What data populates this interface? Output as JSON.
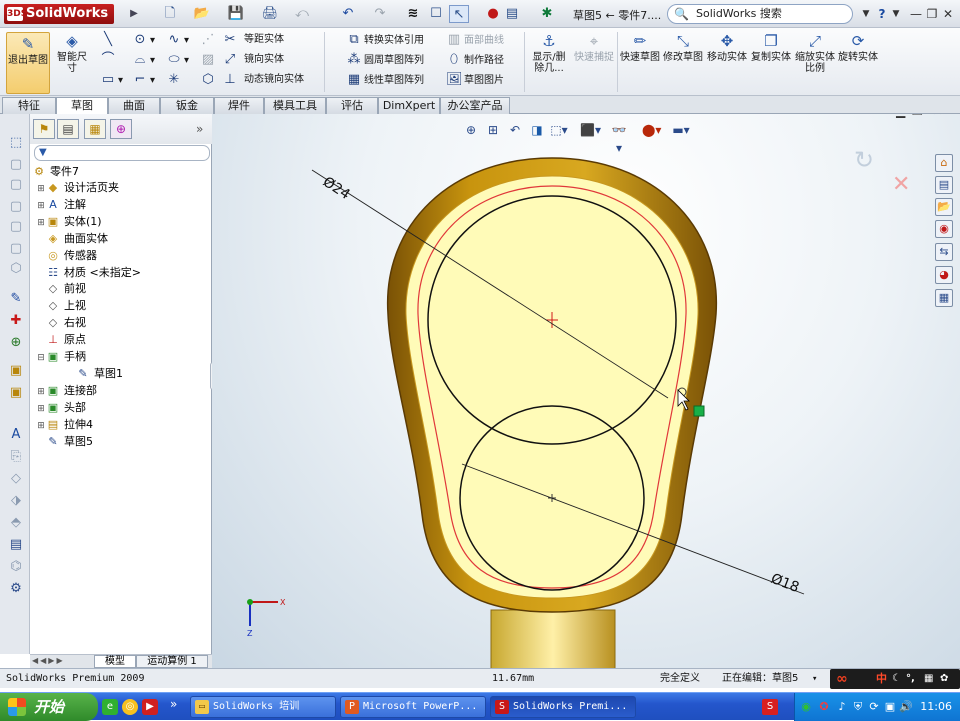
{
  "titlebar": {
    "app_name": "SolidWorks",
    "app_badge": "3DS",
    "document_title": "草图5 ← 零件7....",
    "search_placeholder": "SolidWorks 搜索",
    "help_label": "?"
  },
  "ribbon": {
    "big_buttons": [
      {
        "id": "exit-sketch",
        "label": "退出草图",
        "icon": "exit-sketch-icon"
      },
      {
        "id": "smart-dimension",
        "label": "智能尺寸",
        "icon": "smart-dimension-icon"
      },
      {
        "id": "display-delete-relations",
        "label": "显示/删除几...",
        "icon": "relations-icon"
      },
      {
        "id": "quick-snaps",
        "label": "快速捕捉",
        "icon": "quick-snaps-icon",
        "disabled": true
      },
      {
        "id": "rapid-sketch",
        "label": "快速草图",
        "icon": "rapid-sketch-icon"
      },
      {
        "id": "modify-sketch",
        "label": "修改草图",
        "icon": "modify-sketch-icon"
      },
      {
        "id": "move-entities",
        "label": "移动实体",
        "icon": "move-entities-icon"
      },
      {
        "id": "copy-entities",
        "label": "复制实体",
        "icon": "copy-entities-icon"
      },
      {
        "id": "scale-entities",
        "label": "缩放实体比例",
        "icon": "scale-entities-icon"
      },
      {
        "id": "rotate-entities",
        "label": "旋转实体",
        "icon": "rotate-entities-icon"
      }
    ],
    "small_buttons": [
      {
        "id": "offset",
        "label": "等距实体"
      },
      {
        "id": "mirror",
        "label": "镜向实体"
      },
      {
        "id": "dynamic-mirror",
        "label": "动态镜向实体"
      },
      {
        "id": "convert",
        "label": "转换实体引用"
      },
      {
        "id": "circular-pattern",
        "label": "圆周草图阵列"
      },
      {
        "id": "linear-pattern",
        "label": "线性草图阵列"
      },
      {
        "id": "face-curves",
        "label": "面部曲线",
        "disabled": true
      },
      {
        "id": "make-path",
        "label": "制作路径"
      },
      {
        "id": "sketch-picture",
        "label": "草图图片"
      }
    ]
  },
  "tabs": [
    "特征",
    "草图",
    "曲面",
    "钣金",
    "焊件",
    "模具工具",
    "评估",
    "DimXpert",
    "办公室产品"
  ],
  "active_tab": "草图",
  "tree": {
    "root": "零件7",
    "items": [
      {
        "label": "设计活页夹",
        "icon": "binder-icon",
        "expandable": true,
        "indent": 1
      },
      {
        "label": "注解",
        "icon": "annotation-icon",
        "expandable": true,
        "indent": 1
      },
      {
        "label": "实体(1)",
        "icon": "solid-bodies-icon",
        "expandable": true,
        "indent": 1
      },
      {
        "label": "曲面实体",
        "icon": "surface-bodies-icon",
        "expandable": false,
        "indent": 1
      },
      {
        "label": "传感器",
        "icon": "sensor-icon",
        "expandable": false,
        "indent": 1
      },
      {
        "label": "材质 <未指定>",
        "icon": "material-icon",
        "expandable": false,
        "indent": 1
      },
      {
        "label": "前视",
        "icon": "plane-icon",
        "expandable": false,
        "indent": 1
      },
      {
        "label": "上视",
        "icon": "plane-icon",
        "expandable": false,
        "indent": 1
      },
      {
        "label": "右视",
        "icon": "plane-icon",
        "expandable": false,
        "indent": 1
      },
      {
        "label": "原点",
        "icon": "origin-icon",
        "expandable": false,
        "indent": 1
      },
      {
        "label": "手柄",
        "icon": "feature-icon",
        "expandable": true,
        "expanded": true,
        "indent": 1
      },
      {
        "label": "草图1",
        "icon": "sketch-icon",
        "expandable": false,
        "indent": 2
      },
      {
        "label": "连接部",
        "icon": "feature-icon",
        "expandable": true,
        "indent": 1
      },
      {
        "label": "头部",
        "icon": "feature-icon",
        "expandable": true,
        "indent": 1
      },
      {
        "label": "拉伸4",
        "icon": "extrude-icon",
        "expandable": true,
        "indent": 1
      },
      {
        "label": "草图5",
        "icon": "sketch-icon",
        "expandable": false,
        "indent": 1
      }
    ]
  },
  "bottom_tabs": [
    "模型",
    "运动算例 1"
  ],
  "viewport": {
    "dim_large": "Ø24",
    "dim_small": "Ø18",
    "axis_x": "X",
    "axis_y": "Y",
    "axis_z": "Z"
  },
  "statusbar": {
    "product": "SolidWorks Premium 2009",
    "coord": "11.67mm",
    "defined": "完全定义",
    "editing": "正在编辑：草图5"
  },
  "ime": {
    "lang": "中"
  },
  "taskbar": {
    "start": "开始",
    "items": [
      {
        "label": "SolidWorks 培训",
        "icon": "folder-icon"
      },
      {
        "label": "Microsoft PowerP...",
        "icon": "powerpoint-icon"
      },
      {
        "label": "SolidWorks Premi...",
        "icon": "solidworks-icon",
        "active": true
      }
    ],
    "clock": "11:06"
  },
  "colors": {
    "part_body": "#b8860b",
    "sketch_face": "#fffbb8",
    "sketch_red": "#e0383a",
    "accent": "#2456cc"
  }
}
